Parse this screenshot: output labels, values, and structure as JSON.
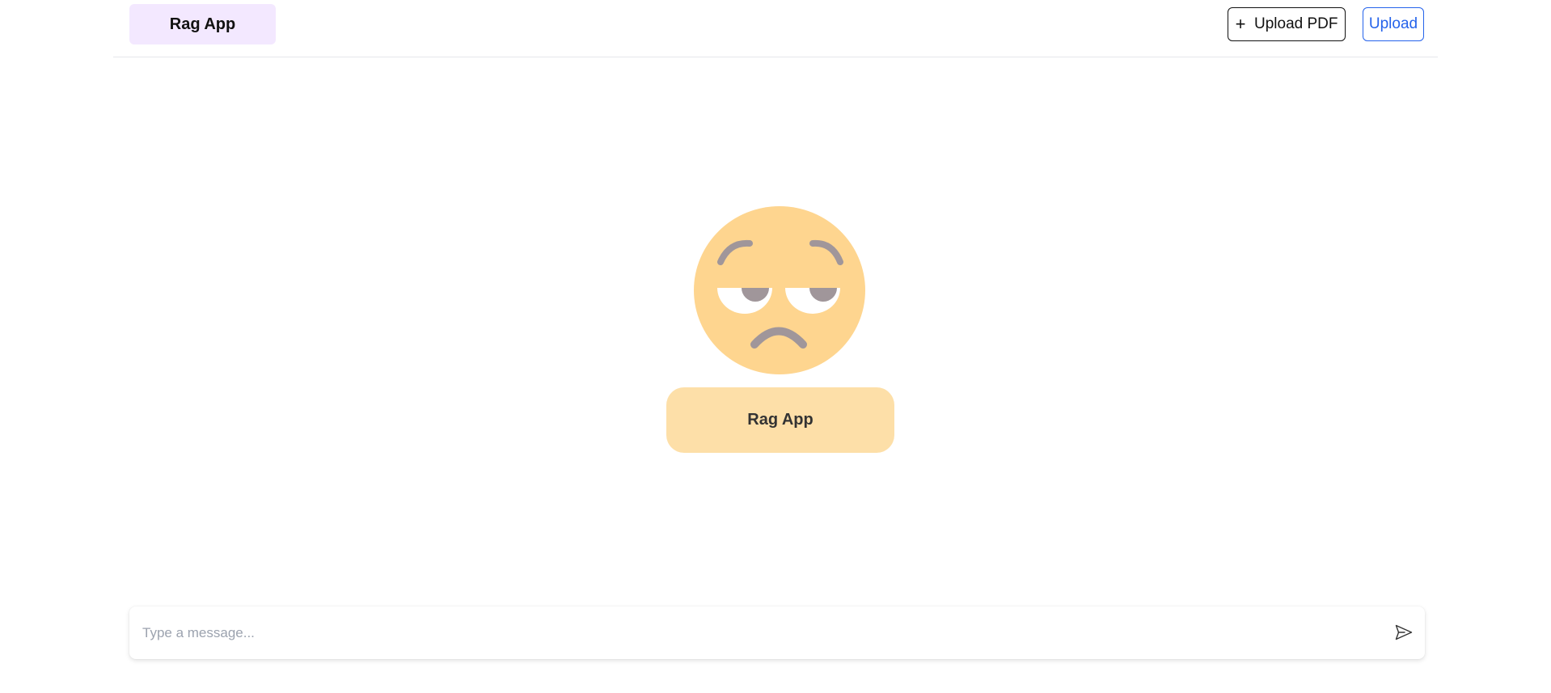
{
  "header": {
    "brand_label": "Rag App",
    "upload_pdf": {
      "icon": "plus-icon",
      "label": "Upload PDF"
    },
    "upload_label": "Upload"
  },
  "hero": {
    "emoji": "unamused-face",
    "label": "Rag App"
  },
  "composer": {
    "placeholder": "Type a message...",
    "value": "",
    "send_icon": "send-icon"
  },
  "colors": {
    "brand_bg": "#f3e8ff",
    "hero_label_bg": "#fddfa8",
    "accent_blue": "#2563eb",
    "emoji_skin": "#fed58f",
    "emoji_features": "#a0969a"
  }
}
